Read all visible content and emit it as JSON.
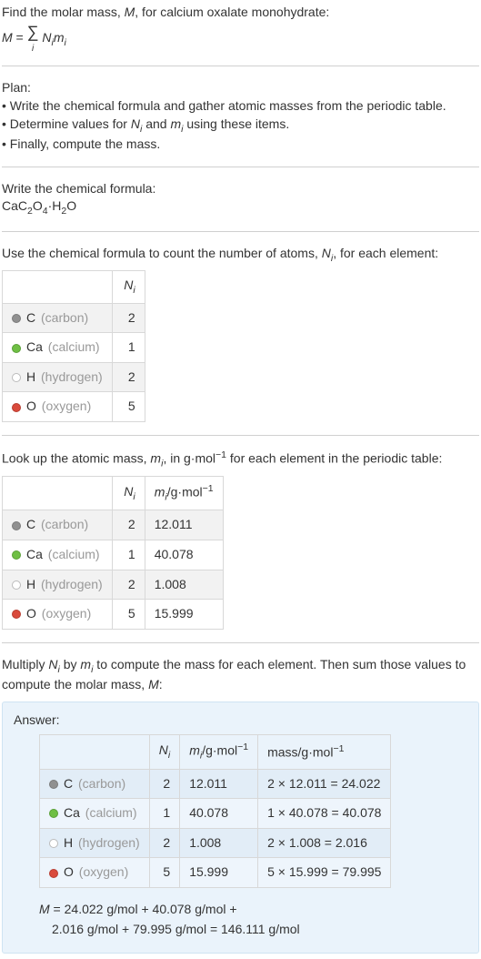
{
  "intro": {
    "line1_pre": "Find the molar mass, ",
    "line1_M": "M",
    "line1_post": ", for calcium oxalate monohydrate:",
    "eq_lhs": "M",
    "eq_eq": " = ",
    "eq_sum_i": "i",
    "eq_Ni": "N",
    "eq_Ni_sub": "i",
    "eq_mi": "m",
    "eq_mi_sub": "i"
  },
  "plan": {
    "heading": "Plan:",
    "b1": "• Write the chemical formula and gather atomic masses from the periodic table.",
    "b2_pre": "• Determine values for ",
    "b2_Ni": "N",
    "b2_Ni_sub": "i",
    "b2_mid": " and ",
    "b2_mi": "m",
    "b2_mi_sub": "i",
    "b2_post": " using these items.",
    "b3": "• Finally, compute the mass."
  },
  "chem": {
    "heading": "Write the chemical formula:",
    "formula_parts": {
      "p1": "CaC",
      "s1": "2",
      "p2": "O",
      "s2": "4",
      "dot": "·H",
      "s3": "2",
      "p3": "O"
    }
  },
  "count": {
    "heading_pre": "Use the chemical formula to count the number of atoms, ",
    "heading_N": "N",
    "heading_N_sub": "i",
    "heading_post": ", for each element:",
    "col_Ni": "N",
    "col_Ni_sub": "i",
    "rows": [
      {
        "swatch": "sw-c",
        "sym": "C",
        "name": "(carbon)",
        "ni": "2"
      },
      {
        "swatch": "sw-ca",
        "sym": "Ca",
        "name": "(calcium)",
        "ni": "1"
      },
      {
        "swatch": "sw-h",
        "sym": "H",
        "name": "(hydrogen)",
        "ni": "2"
      },
      {
        "swatch": "sw-o",
        "sym": "O",
        "name": "(oxygen)",
        "ni": "5"
      }
    ]
  },
  "mass": {
    "heading_pre": "Look up the atomic mass, ",
    "heading_m": "m",
    "heading_m_sub": "i",
    "heading_mid": ", in g·mol",
    "heading_exp": "−1",
    "heading_post": " for each element in the periodic table:",
    "col_Ni": "N",
    "col_Ni_sub": "i",
    "col_mi_pre": "m",
    "col_mi_sub": "i",
    "col_mi_unit": "/g·mol",
    "col_mi_exp": "−1",
    "rows": [
      {
        "swatch": "sw-c",
        "sym": "C",
        "name": "(carbon)",
        "ni": "2",
        "mi": "12.011"
      },
      {
        "swatch": "sw-ca",
        "sym": "Ca",
        "name": "(calcium)",
        "ni": "1",
        "mi": "40.078"
      },
      {
        "swatch": "sw-h",
        "sym": "H",
        "name": "(hydrogen)",
        "ni": "2",
        "mi": "1.008"
      },
      {
        "swatch": "sw-o",
        "sym": "O",
        "name": "(oxygen)",
        "ni": "5",
        "mi": "15.999"
      }
    ]
  },
  "multiply": {
    "pre": "Multiply ",
    "Ni": "N",
    "Ni_sub": "i",
    "mid": " by ",
    "mi": "m",
    "mi_sub": "i",
    "post1": " to compute the mass for each element. Then sum those values to compute the molar mass, ",
    "M": "M",
    "post2": ":"
  },
  "answer": {
    "label": "Answer:",
    "col_Ni": "N",
    "col_Ni_sub": "i",
    "col_mi_pre": "m",
    "col_mi_sub": "i",
    "col_mi_unit": "/g·mol",
    "col_mi_exp": "−1",
    "col_mass_pre": "mass/g·mol",
    "col_mass_exp": "−1",
    "rows": [
      {
        "swatch": "sw-c",
        "sym": "C",
        "name": "(carbon)",
        "ni": "2",
        "mi": "12.011",
        "mass": "2 × 12.011 = 24.022"
      },
      {
        "swatch": "sw-ca",
        "sym": "Ca",
        "name": "(calcium)",
        "ni": "1",
        "mi": "40.078",
        "mass": "1 × 40.078 = 40.078"
      },
      {
        "swatch": "sw-h",
        "sym": "H",
        "name": "(hydrogen)",
        "ni": "2",
        "mi": "1.008",
        "mass": "2 × 1.008 = 2.016"
      },
      {
        "swatch": "sw-o",
        "sym": "O",
        "name": "(oxygen)",
        "ni": "5",
        "mi": "15.999",
        "mass": "5 × 15.999 = 79.995"
      }
    ],
    "eq_line1_pre": "M",
    "eq_line1": " = 24.022 g/mol + 40.078 g/mol + ",
    "eq_line2": "2.016 g/mol + 79.995 g/mol = 146.111 g/mol"
  }
}
